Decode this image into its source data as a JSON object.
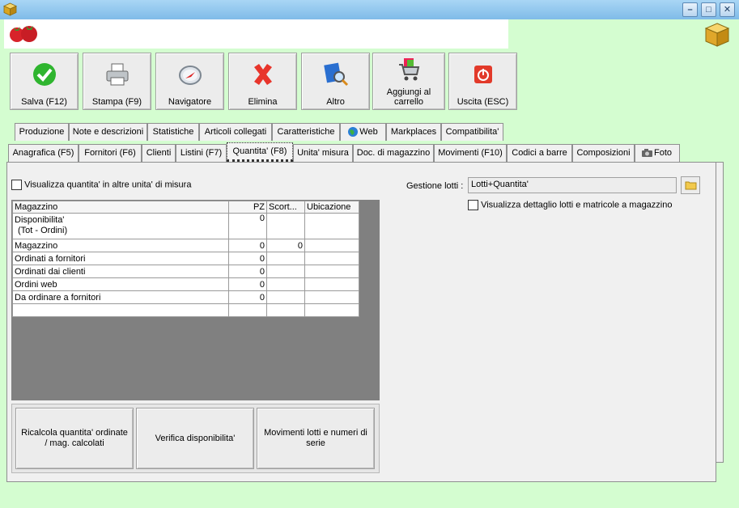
{
  "toolbar": {
    "buttons": [
      {
        "label": "Salva (F12)",
        "icon": "check-icon"
      },
      {
        "label": "Stampa (F9)",
        "icon": "printer-icon"
      },
      {
        "label": "Navigatore",
        "icon": "compass-icon"
      },
      {
        "label": "Elimina",
        "icon": "delete-icon"
      },
      {
        "label": "Altro",
        "icon": "magnifier-icon"
      },
      {
        "label": "Aggiungi al carrello",
        "icon": "cart-icon"
      },
      {
        "label": "Uscita (ESC)",
        "icon": "power-icon"
      }
    ]
  },
  "tabs_row1": [
    "Produzione",
    "Note e descrizioni",
    "Statistiche",
    "Articoli collegati",
    "Caratteristiche",
    "Web",
    "Markplaces",
    "Compatibilita'"
  ],
  "tabs_row2": [
    "Anagrafica (F5)",
    "Fornitori (F6)",
    "Clienti",
    "Listini (F7)",
    "Quantita' (F8)",
    "Unita' misura",
    "Doc. di magazzino",
    "Movimenti (F10)",
    "Codici a barre",
    "Composizioni",
    "Foto"
  ],
  "panel": {
    "show_other_units_label": "Visualizza quantita' in altre unita' di misura",
    "lot_management_label": "Gestione lotti :",
    "lot_management_value": "Lotti+Quantita'",
    "show_lot_detail_label": "Visualizza dettaglio lotti e matricole a magazzino"
  },
  "grid": {
    "headers": [
      "Magazzino",
      "PZ",
      "Scort...",
      "Ubicazione"
    ],
    "rows": [
      {
        "name": "Disponibilita'",
        "sub": "(Tot - Ordini)",
        "pz": "0",
        "scorta": "",
        "ubicazione": ""
      },
      {
        "name": "Magazzino",
        "sub": "",
        "pz": "0",
        "scorta": "0",
        "ubicazione": ""
      },
      {
        "name": "Ordinati a fornitori",
        "sub": "",
        "pz": "0",
        "scorta": "",
        "ubicazione": ""
      },
      {
        "name": "Ordinati dai clienti",
        "sub": "",
        "pz": "0",
        "scorta": "",
        "ubicazione": ""
      },
      {
        "name": "Ordini web",
        "sub": "",
        "pz": "0",
        "scorta": "",
        "ubicazione": ""
      },
      {
        "name": "Da ordinare a fornitori",
        "sub": "",
        "pz": "0",
        "scorta": "",
        "ubicazione": ""
      },
      {
        "name": "",
        "sub": "",
        "pz": "",
        "scorta": "",
        "ubicazione": ""
      }
    ]
  },
  "bottom_buttons": [
    "Ricalcola quantita' ordinate / mag. calcolati",
    "Verifica disponibilita'",
    "Movimenti lotti e numeri di serie"
  ],
  "window_buttons": {
    "minimize": "–",
    "maximize": "□",
    "close": "✕"
  }
}
